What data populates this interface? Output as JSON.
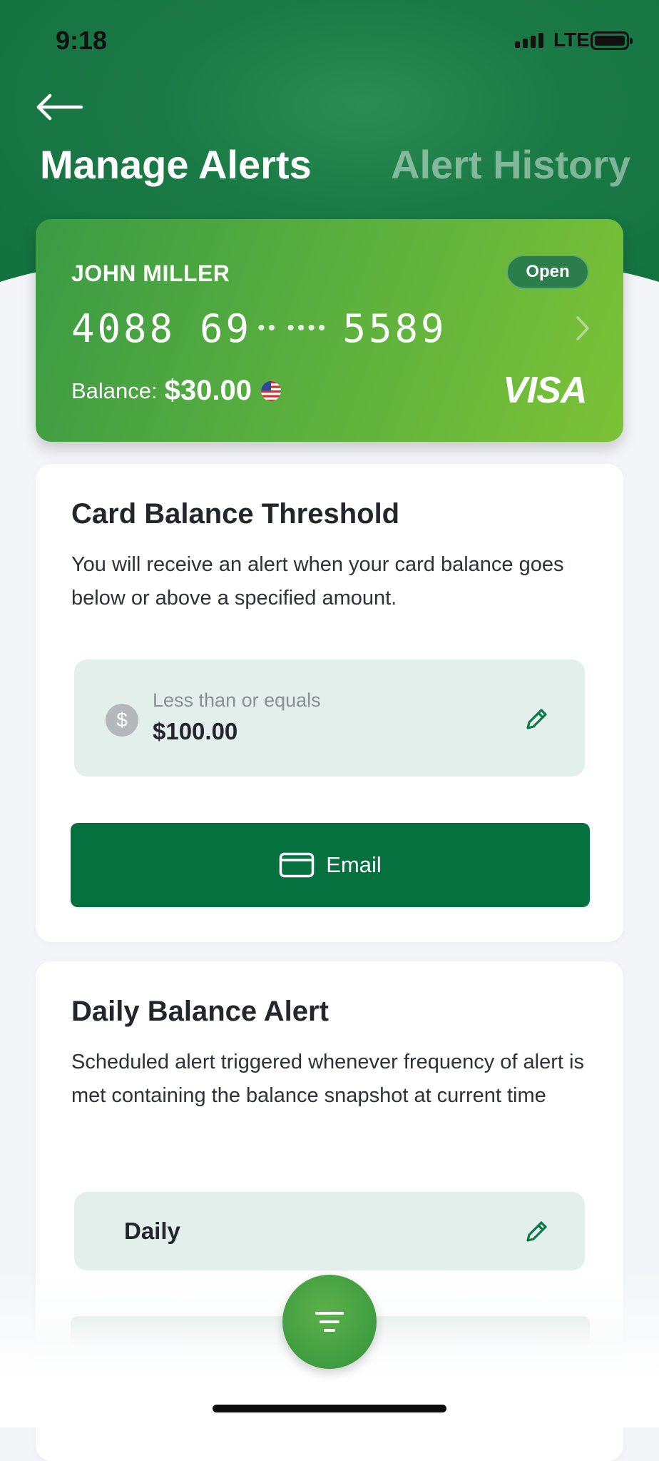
{
  "status_bar": {
    "time": "9:18",
    "network": "LTE"
  },
  "header": {
    "tabs": [
      {
        "label": "Manage Alerts",
        "active": true
      },
      {
        "label": "Alert History",
        "active": false
      }
    ]
  },
  "card": {
    "holder": "JOHN MILLER",
    "status": "Open",
    "number_first": "4088",
    "number_second": "69",
    "number_masked": "•• ••••",
    "number_last": "5589",
    "balance_label": "Balance:",
    "balance_value": "$30.00",
    "network": "VISA"
  },
  "threshold": {
    "title": "Card Balance Threshold",
    "description": "You will receive an alert when your card balance goes below or above a specified amount.",
    "condition_label": "Less than or equals",
    "amount": "$100.00",
    "currency_symbol": "$",
    "channel_button": "Email"
  },
  "daily": {
    "title": "Daily Balance Alert",
    "description": "Scheduled alert triggered whenever frequency of alert is met containing the balance snapshot at current time",
    "frequency": "Daily"
  },
  "colors": {
    "header_green": "#1a7a45",
    "card_gradient_start": "#3a9a44",
    "card_gradient_end": "#7cc236",
    "button_green": "#04713f",
    "value_box_bg": "#e3efea",
    "fab_green": "#3f9d40"
  },
  "icons": {
    "back": "back-arrow-icon",
    "chevron": "chevron-right-icon",
    "flag": "us-flag-icon",
    "dollar": "dollar-icon",
    "edit": "pencil-icon",
    "email": "envelope-icon",
    "filter": "filter-icon"
  }
}
